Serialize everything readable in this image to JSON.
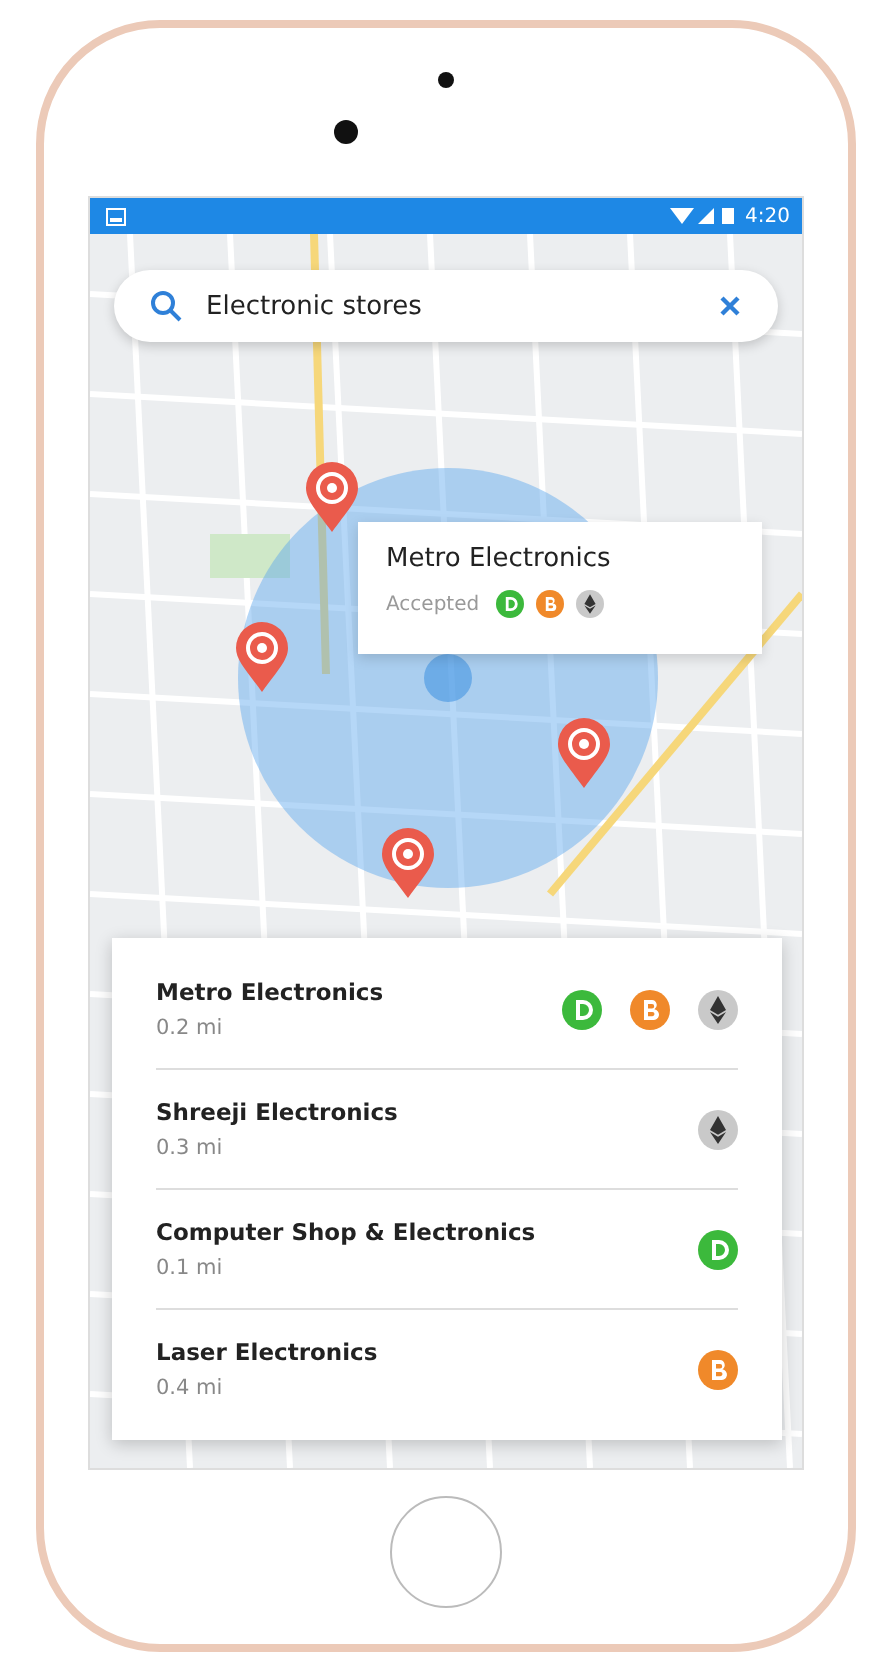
{
  "status_bar": {
    "time": "4:20"
  },
  "search": {
    "value": "Electronic stores"
  },
  "popup": {
    "name": "Metro Electronics",
    "label": "Accepted",
    "coins": [
      {
        "kind": "dogecoin",
        "color": "#3cb93c"
      },
      {
        "kind": "bitcoin",
        "color": "#f0892a"
      },
      {
        "kind": "ethereum",
        "color": "#c9c9c9"
      }
    ]
  },
  "stores": [
    {
      "name": "Metro Electronics",
      "distance": "0.2 mi",
      "coins": [
        {
          "kind": "dogecoin",
          "color": "#3cb93c"
        },
        {
          "kind": "bitcoin",
          "color": "#f0892a"
        },
        {
          "kind": "ethereum",
          "color": "#c9c9c9"
        }
      ]
    },
    {
      "name": "Shreeji Electronics",
      "distance": "0.3 mi",
      "coins": [
        {
          "kind": "ethereum",
          "color": "#c9c9c9"
        }
      ]
    },
    {
      "name": "Computer Shop & Electronics",
      "distance": "0.1 mi",
      "coins": [
        {
          "kind": "dogecoin",
          "color": "#3cb93c"
        }
      ]
    },
    {
      "name": "Laser Electronics",
      "distance": "0.4 mi",
      "coins": [
        {
          "kind": "bitcoin",
          "color": "#f0892a"
        }
      ]
    }
  ]
}
